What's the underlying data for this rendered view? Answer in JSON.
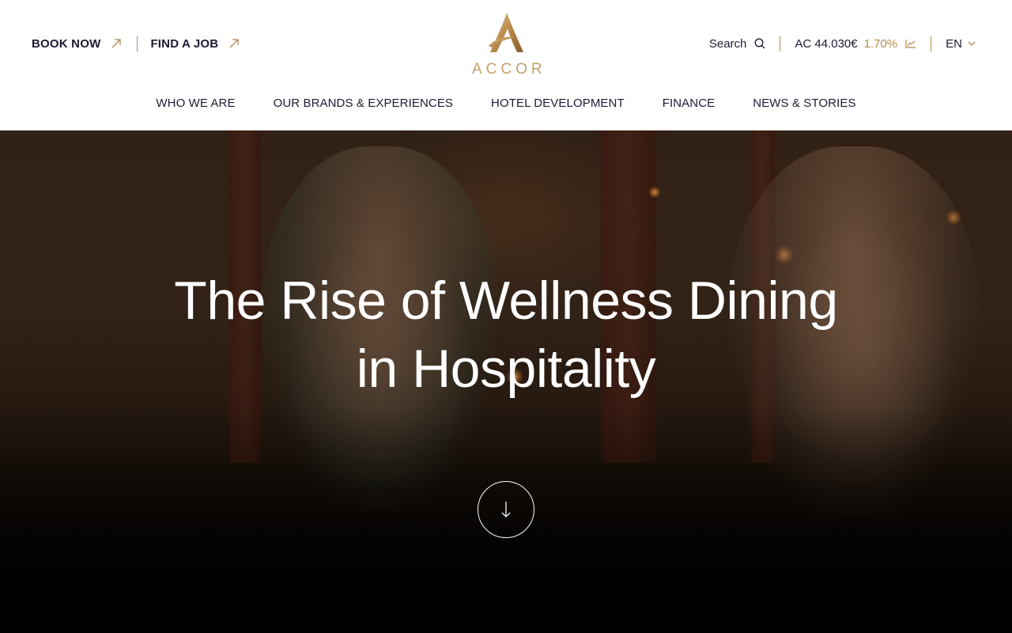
{
  "header": {
    "book_now": "BOOK NOW",
    "find_a_job": "FIND A JOB",
    "brand_name": "ACCOR",
    "search_label": "Search",
    "stock": {
      "price": "AC 44.030€",
      "change": "1.70%"
    },
    "language": "EN",
    "nav": [
      "WHO WE ARE",
      "OUR BRANDS & EXPERIENCES",
      "HOTEL DEVELOPMENT",
      "FINANCE",
      "NEWS & STORIES"
    ]
  },
  "hero": {
    "title_line1": "The Rise of Wellness Dining",
    "title_line2": "in Hospitality",
    "scroll_icon": "arrow-down-icon"
  },
  "colors": {
    "navy_text": "#1c1b33",
    "gold_accent": "#b48a4a",
    "logo_gold": "#c5a06a",
    "hero_text": "#ffffff"
  }
}
